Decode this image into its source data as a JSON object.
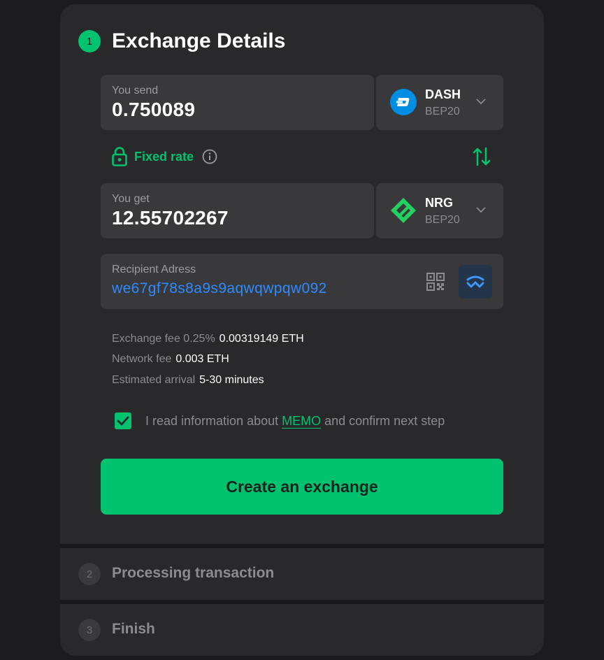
{
  "steps": [
    {
      "number": "1",
      "title": "Exchange Details"
    },
    {
      "number": "2",
      "title": "Processing transaction"
    },
    {
      "number": "3",
      "title": "Finish"
    }
  ],
  "send": {
    "label": "You send",
    "amount": "0.750089",
    "currency": {
      "ticker": "DASH",
      "network": "BEP20",
      "icon": "dash-coin-icon",
      "color": "#008de4"
    }
  },
  "rate": {
    "label": "Fixed rate",
    "lock_icon": "lock-icon",
    "info_icon": "info-icon",
    "swap_icon": "swap-arrows-icon"
  },
  "get": {
    "label": "You get",
    "amount": "12.55702267",
    "currency": {
      "ticker": "NRG",
      "network": "BEP20",
      "icon": "nrg-coin-icon",
      "color": "#23d160"
    }
  },
  "recipient": {
    "label": "Recipient Adress",
    "address": "we67gf78s8a9s9aqwqwpqw092",
    "qr_icon": "qr-code-icon",
    "wallet_icon": "walletconnect-icon"
  },
  "fees": [
    {
      "key": "Exchange fee 0.25%",
      "value": "0.00319149 ETH"
    },
    {
      "key": "Network fee",
      "value": "0.003 ETH"
    },
    {
      "key": "Estimated arrival",
      "value": "5-30 minutes"
    }
  ],
  "confirm": {
    "checked": true,
    "text_before": "I read information about ",
    "link": "MEMO",
    "text_after": " and confirm next step"
  },
  "cta_label": "Create an exchange",
  "colors": {
    "accent": "#00c26f",
    "link": "#2e8bff",
    "panel": "#29292b",
    "field": "#39393c"
  }
}
